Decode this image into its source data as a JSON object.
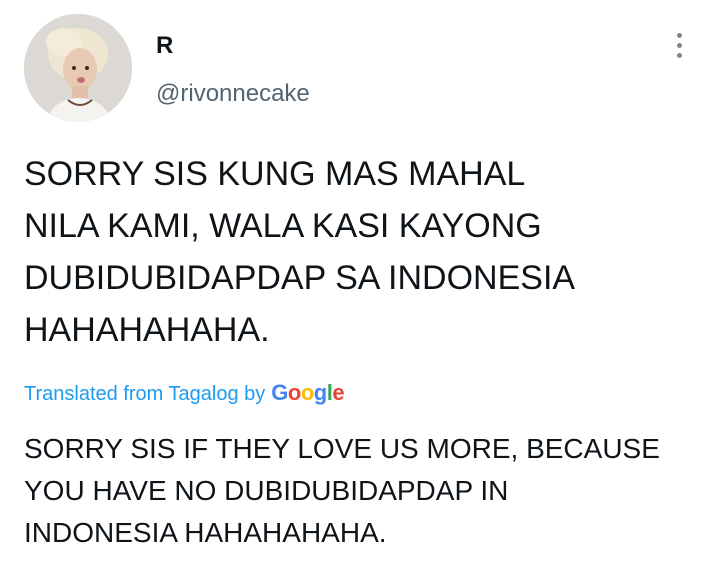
{
  "tweet": {
    "display_name": "R",
    "handle": "@rivonnecake",
    "text_lines": [
      "SORRY SIS KUNG MAS MAHAL",
      "NILA KAMI, WALA KASI KAYONG",
      "DUBIDUBIDAPDAP SA INDONESIA",
      "HAHAHAHAHA."
    ]
  },
  "translation": {
    "label": "Translated from Tagalog by",
    "provider_letters": [
      "G",
      "o",
      "o",
      "g",
      "l",
      "e"
    ],
    "text_lines": [
      "SORRY SIS IF THEY LOVE US MORE, BECAUSE",
      "YOU HAVE NO DUBIDUBIDAPDAP IN",
      "INDONESIA HAHAHAHAHA."
    ]
  },
  "icons": {
    "more": "more-vertical-icon",
    "avatar": "profile-photo"
  },
  "colors": {
    "text": "#0f1419",
    "secondary": "#536471",
    "link": "#1d9bf0"
  }
}
